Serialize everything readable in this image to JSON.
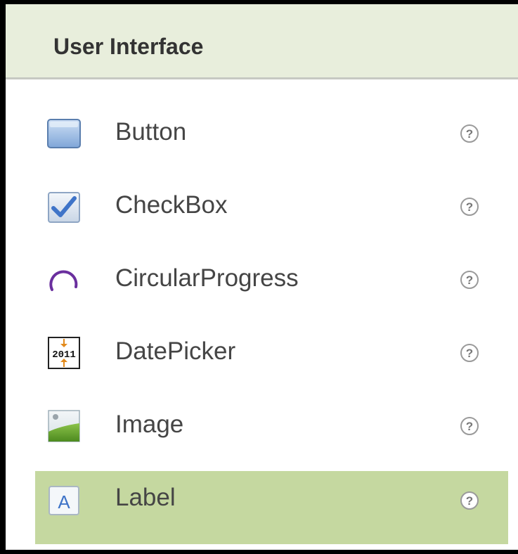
{
  "panel": {
    "title": "User Interface",
    "items": [
      {
        "label": "Button",
        "icon": "button-icon",
        "selected": false
      },
      {
        "label": "CheckBox",
        "icon": "checkbox-icon",
        "selected": false
      },
      {
        "label": "CircularProgress",
        "icon": "circular-progress-icon",
        "selected": false
      },
      {
        "label": "DatePicker",
        "icon": "datepicker-icon",
        "icon_text": "2011",
        "selected": false
      },
      {
        "label": "Image",
        "icon": "image-icon",
        "selected": false
      },
      {
        "label": "Label",
        "icon": "label-icon",
        "icon_text": "A",
        "selected": true
      }
    ],
    "help_icon": "help-icon",
    "colors": {
      "header_bg": "#e8eedc",
      "selected_bg": "#c5d8a0",
      "text": "#454545"
    }
  }
}
